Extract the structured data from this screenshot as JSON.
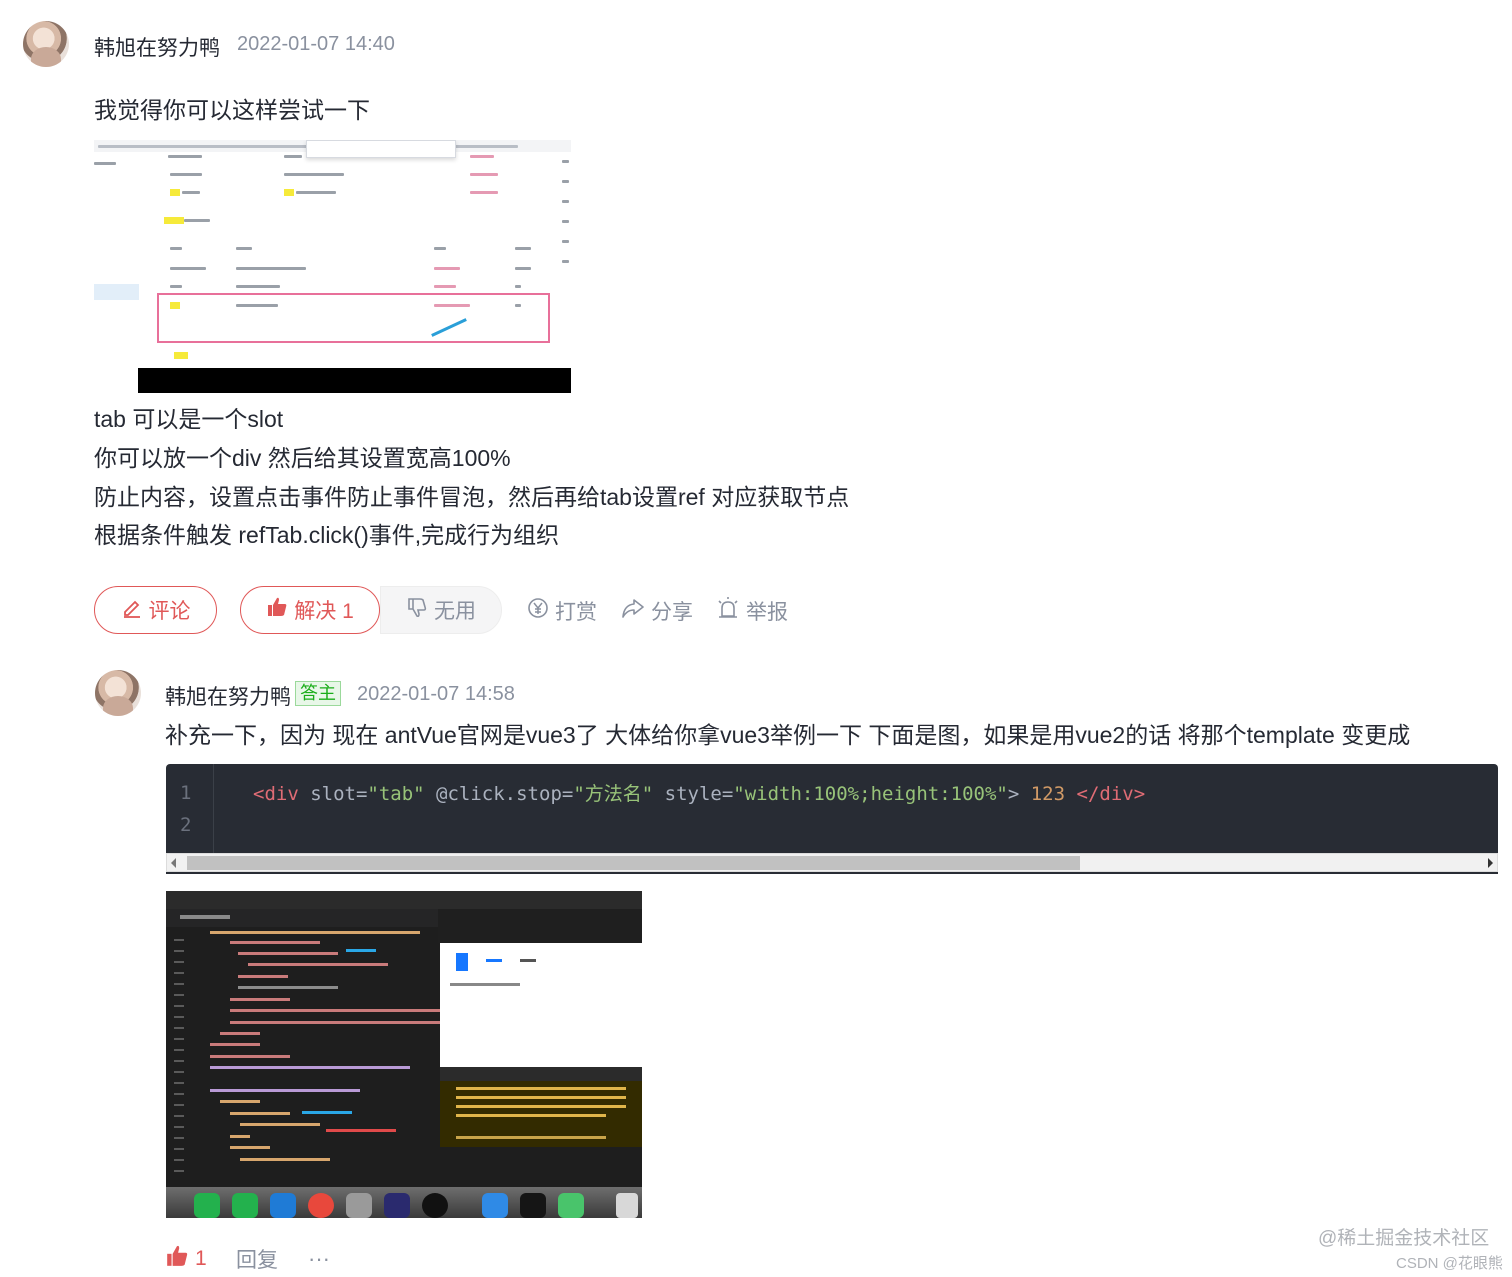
{
  "comment1": {
    "author": "韩旭在努力鸭",
    "time": "2022-01-07 14:40",
    "intro": "我觉得你可以这样尝试一下",
    "screenshot_alt": "文档截图",
    "lines": [
      "tab 可以是一个slot",
      "你可以放一个div 然后给其设置宽高100%",
      "防止内容，设置点击事件防止事件冒泡，然后再给tab设置ref 对应获取节点",
      "根据条件触发 refTab.click()事件,完成行为组织"
    ]
  },
  "actions": {
    "comment": "评论",
    "solve": "解决 1",
    "useless": "无用",
    "reward": "打赏",
    "share": "分享",
    "report": "举报"
  },
  "reply": {
    "author": "韩旭在努力鸭",
    "badge": "答主",
    "time": "2022-01-07 14:58",
    "text": "补充一下，因为 现在 antVue官网是vue3了 大体给你拿vue3举例一下 下面是图，如果是用vue2的话 将那个template 变更成",
    "code": {
      "line_numbers": [
        "1",
        "2"
      ],
      "open_tag": "<div",
      "attr1": " slot=",
      "val1": "\"tab\"",
      "attr2": " @click.stop=",
      "val2": "\"方法名\"",
      "attr3": " style=",
      "val3": "\"width:100%;height:100%\"",
      "gt": ">",
      "content": " 123 ",
      "close_tag": "</div>"
    },
    "like_count": "1",
    "reply_label": "回复",
    "more_label": "···"
  },
  "watermarks": {
    "juejin": "@稀土掘金技术社区",
    "csdn": "CSDN @花眼熊"
  },
  "colors": {
    "accent_red": "#e05858",
    "muted": "#8a919f",
    "code_bg": "#282c34"
  }
}
